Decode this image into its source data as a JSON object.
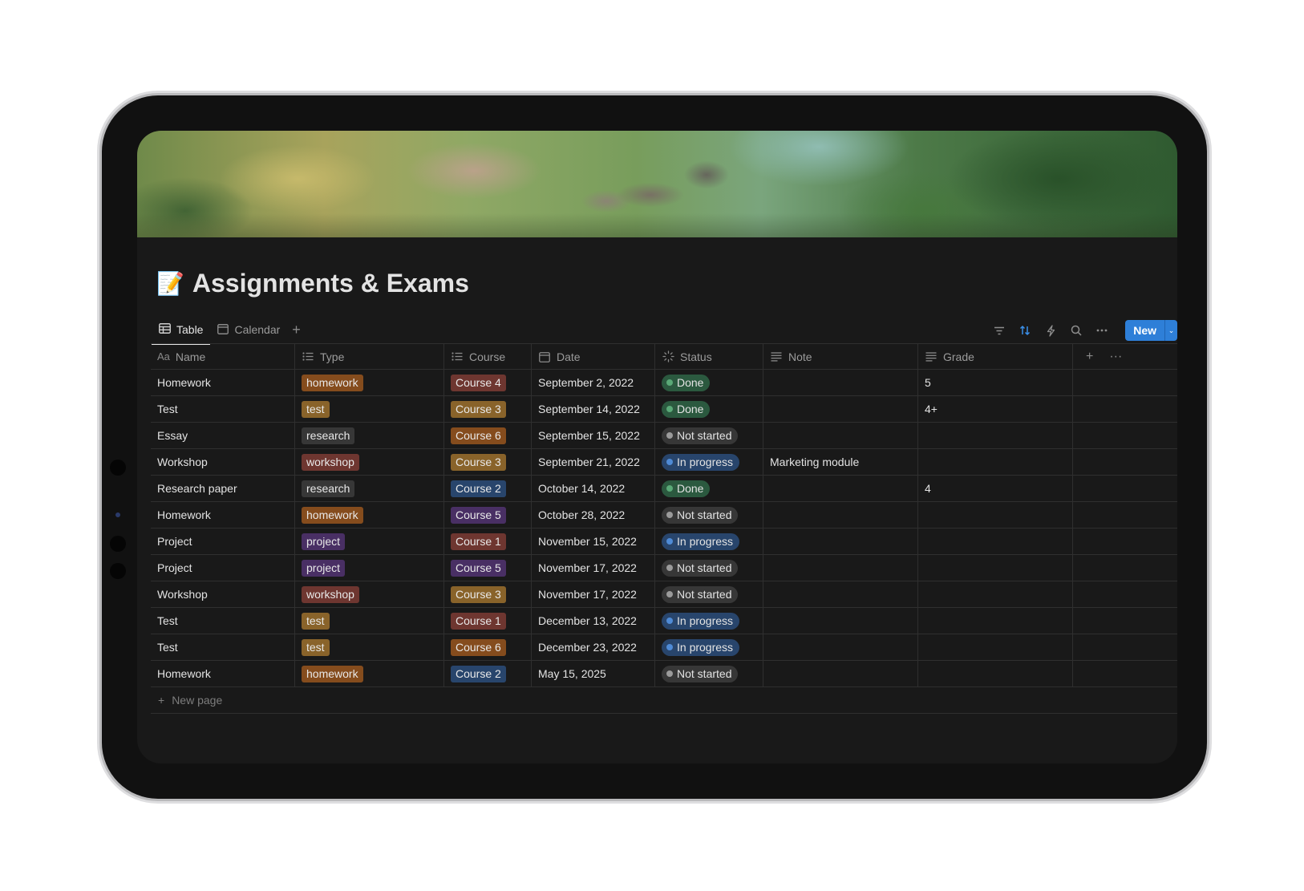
{
  "page": {
    "emoji": "📝",
    "title": "Assignments & Exams"
  },
  "views": {
    "tabs": [
      {
        "label": "Table",
        "icon": "table-icon",
        "active": true
      },
      {
        "label": "Calendar",
        "icon": "calendar-icon",
        "active": false
      }
    ],
    "add_symbol": "+"
  },
  "toolbar": {
    "icons": [
      "filter-icon",
      "sort-icon",
      "lightning-icon",
      "search-icon",
      "more-icon"
    ],
    "new_label": "New",
    "new_caret": "⌄"
  },
  "columns": {
    "name": {
      "prefix": "Aa",
      "label": "Name"
    },
    "type": {
      "label": "Type",
      "icon": "list-icon"
    },
    "course": {
      "label": "Course",
      "icon": "list-icon"
    },
    "date": {
      "label": "Date",
      "icon": "calendar-icon"
    },
    "status": {
      "label": "Status",
      "icon": "status-icon"
    },
    "note": {
      "label": "Note",
      "icon": "text-icon"
    },
    "grade": {
      "label": "Grade",
      "icon": "text-icon"
    },
    "add_symbol": "+",
    "more_symbol": "···"
  },
  "rows": [
    {
      "name": "Homework",
      "type": "homework",
      "course": "Course 4",
      "date": "September 2, 2022",
      "status": "Done",
      "note": "",
      "grade": "5"
    },
    {
      "name": "Test",
      "type": "test",
      "course": "Course 3",
      "date": "September 14, 2022",
      "status": "Done",
      "note": "",
      "grade": "4+"
    },
    {
      "name": "Essay",
      "type": "research",
      "course": "Course 6",
      "date": "September 15, 2022",
      "status": "Not started",
      "note": "",
      "grade": ""
    },
    {
      "name": "Workshop",
      "type": "workshop",
      "course": "Course 3",
      "date": "September 21, 2022",
      "status": "In progress",
      "note": "Marketing module",
      "grade": ""
    },
    {
      "name": "Research paper",
      "type": "research",
      "course": "Course 2",
      "date": "October 14, 2022",
      "status": "Done",
      "note": "",
      "grade": "4"
    },
    {
      "name": "Homework",
      "type": "homework",
      "course": "Course 5",
      "date": "October 28, 2022",
      "status": "Not started",
      "note": "",
      "grade": ""
    },
    {
      "name": "Project",
      "type": "project",
      "course": "Course 1",
      "date": "November 15, 2022",
      "status": "In progress",
      "note": "",
      "grade": ""
    },
    {
      "name": "Project",
      "type": "project",
      "course": "Course 5",
      "date": "November 17, 2022",
      "status": "Not started",
      "note": "",
      "grade": ""
    },
    {
      "name": "Workshop",
      "type": "workshop",
      "course": "Course 3",
      "date": "November 17, 2022",
      "status": "Not started",
      "note": "",
      "grade": ""
    },
    {
      "name": "Test",
      "type": "test",
      "course": "Course 1",
      "date": "December 13, 2022",
      "status": "In progress",
      "note": "",
      "grade": ""
    },
    {
      "name": "Test",
      "type": "test",
      "course": "Course 6",
      "date": "December 23, 2022",
      "status": "In progress",
      "note": "",
      "grade": ""
    },
    {
      "name": "Homework",
      "type": "homework",
      "course": "Course 2",
      "date": "May 15, 2025",
      "status": "Not started",
      "note": "",
      "grade": ""
    }
  ],
  "new_page_label": "New page",
  "colors": {
    "type": {
      "homework": "#854c1d",
      "test": "#89632a",
      "research": "#373737",
      "workshop": "#6e3630",
      "project": "#492f64"
    },
    "course": {
      "Course 1": "#6e3630",
      "Course 2": "#28456c",
      "Course 3": "#89632a",
      "Course 4": "#6e3630",
      "Course 5": "#492f64",
      "Course 6": "#854c1d"
    },
    "status": {
      "Done": {
        "bg": "#2b593f",
        "dot": "#5aa977"
      },
      "Not started": {
        "bg": "#373737",
        "dot": "#9b9b9b"
      },
      "In progress": {
        "bg": "#28456c",
        "dot": "#4f8bd6"
      }
    },
    "accent": "#2e7fd8"
  }
}
